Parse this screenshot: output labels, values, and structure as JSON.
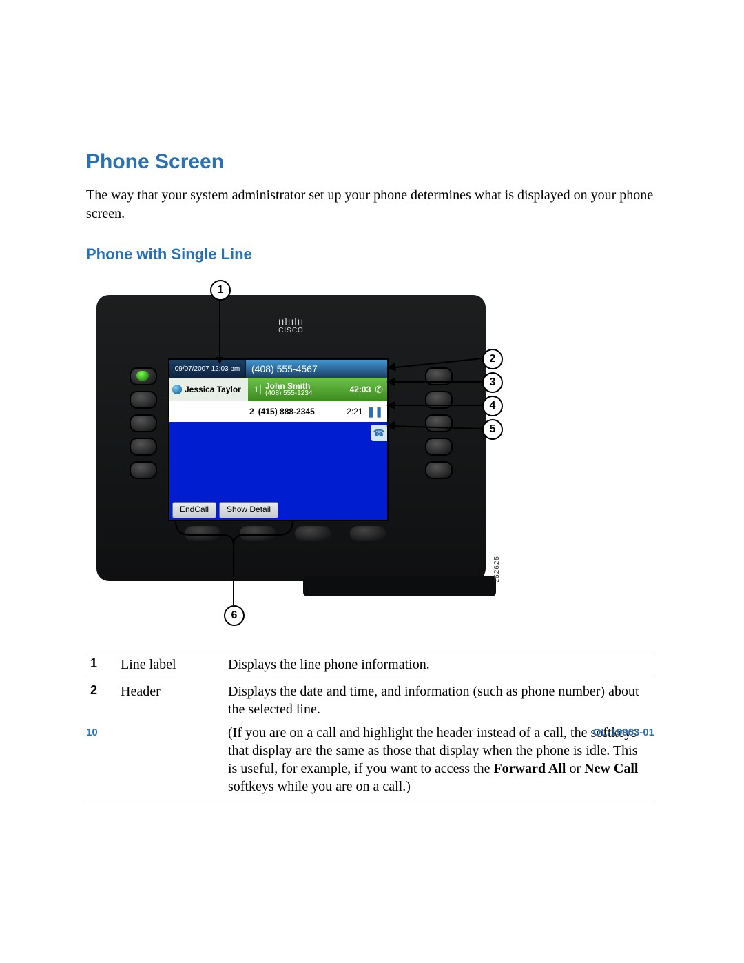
{
  "heading": "Phone Screen",
  "intro": "The way that your system administrator set up your phone determines what is displayed on your phone screen.",
  "subheading": "Phone with Single Line",
  "logo_brand": "CISCO",
  "screen": {
    "date": "09/07/2007",
    "time": "12:03 pm",
    "header_number": "(408) 555-4567",
    "line_label": "Jessica Taylor",
    "call1_index": "1",
    "call1_name": "John Smith",
    "call1_number": "(408) 555-1234",
    "call1_duration": "42:03",
    "call2_index": "2",
    "call2_number": "(415) 888-2345",
    "call2_duration": "2:21",
    "info_glyph": "☎",
    "softkey1": "EndCall",
    "softkey2": "Show Detail"
  },
  "image_id": "252625",
  "callouts": {
    "c1": "1",
    "c2": "2",
    "c3": "3",
    "c4": "4",
    "c5": "5",
    "c6": "6"
  },
  "table": {
    "r1_num": "1",
    "r1_name": "Line label",
    "r1_desc": "Displays the line phone information.",
    "r2_num": "2",
    "r2_name": "Header",
    "r2_desc_a": "Displays the date and time, and information (such as phone number) about the selected line.",
    "r2_desc_b_pre": "(If you are on a call and highlight the header instead of a call, the softkeys that display are the same as those that display when the phone is idle. This is useful, for example, if you want to access the ",
    "r2_desc_b_bold1": "Forward All",
    "r2_desc_b_mid": " or ",
    "r2_desc_b_bold2": "New Call",
    "r2_desc_b_post": " softkeys while you are on a call.)"
  },
  "footer_page": "10",
  "footer_doc": "OL-19963-01"
}
